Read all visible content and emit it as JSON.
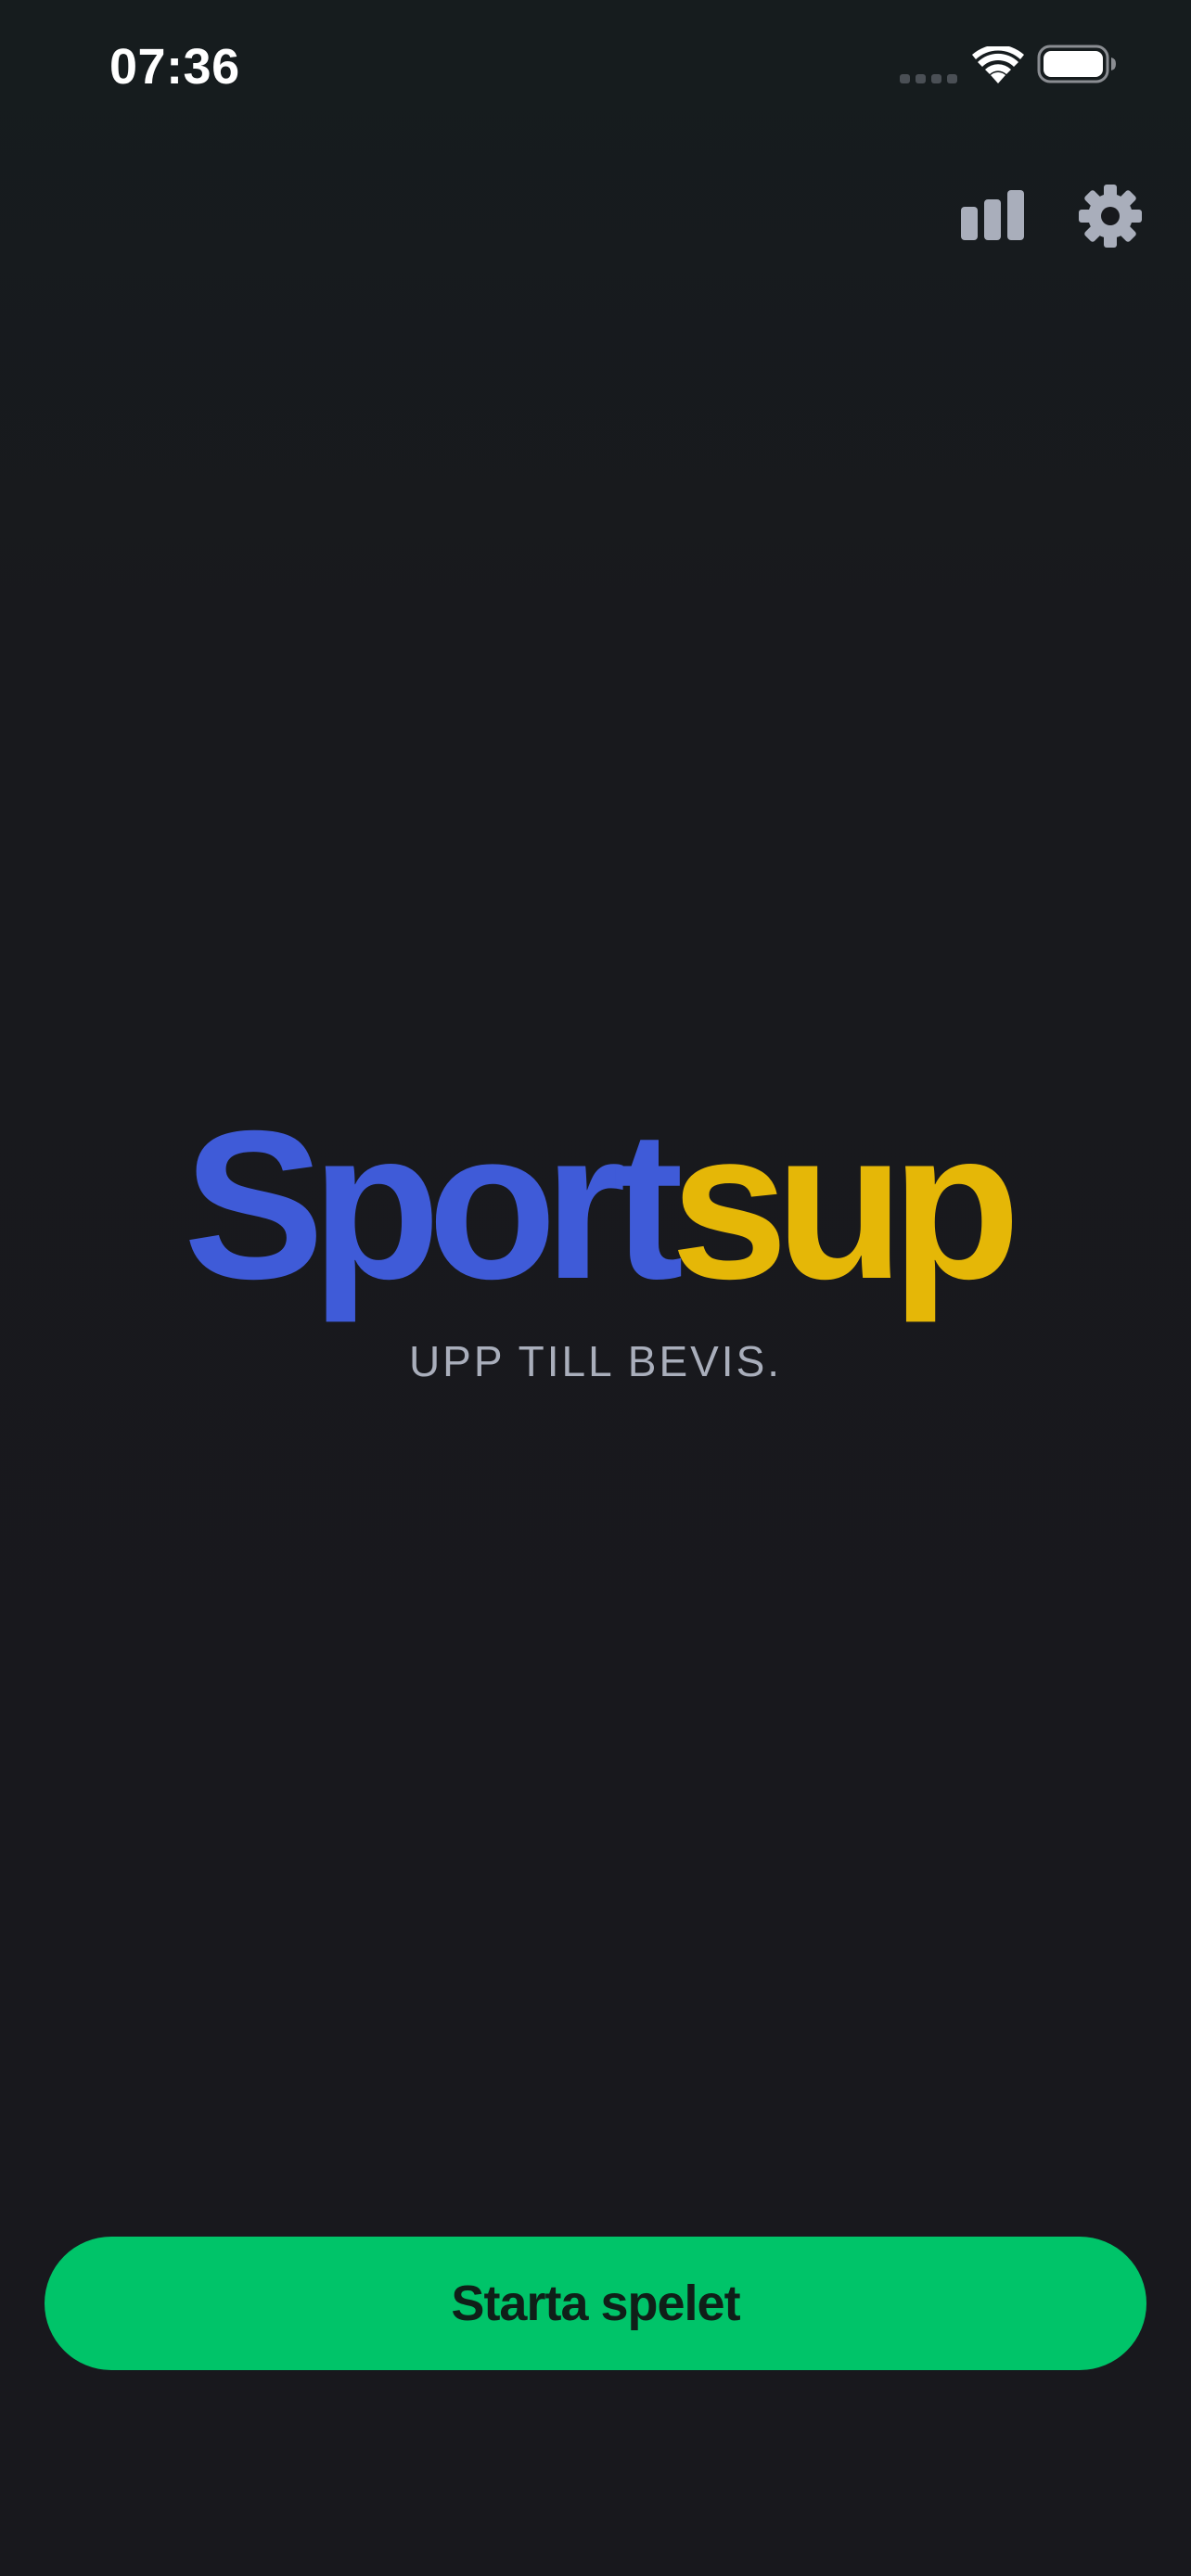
{
  "status_bar": {
    "time": "07:36",
    "icons": [
      "cellular-signal-icon",
      "wifi-icon",
      "battery-icon"
    ]
  },
  "toolbar": {
    "icons": [
      "bar-chart-icon",
      "gear-icon"
    ]
  },
  "logo": {
    "part_1": "Sport",
    "part_2": "sup",
    "part_1_color": "#3f5bd8",
    "part_2_color": "#e5b707"
  },
  "tagline": "UPP TILL BEVIS.",
  "start_button": {
    "label": "Starta spelet",
    "color": "#00c469"
  },
  "colors": {
    "background": "#18181d",
    "icon": "#a9aebb"
  }
}
